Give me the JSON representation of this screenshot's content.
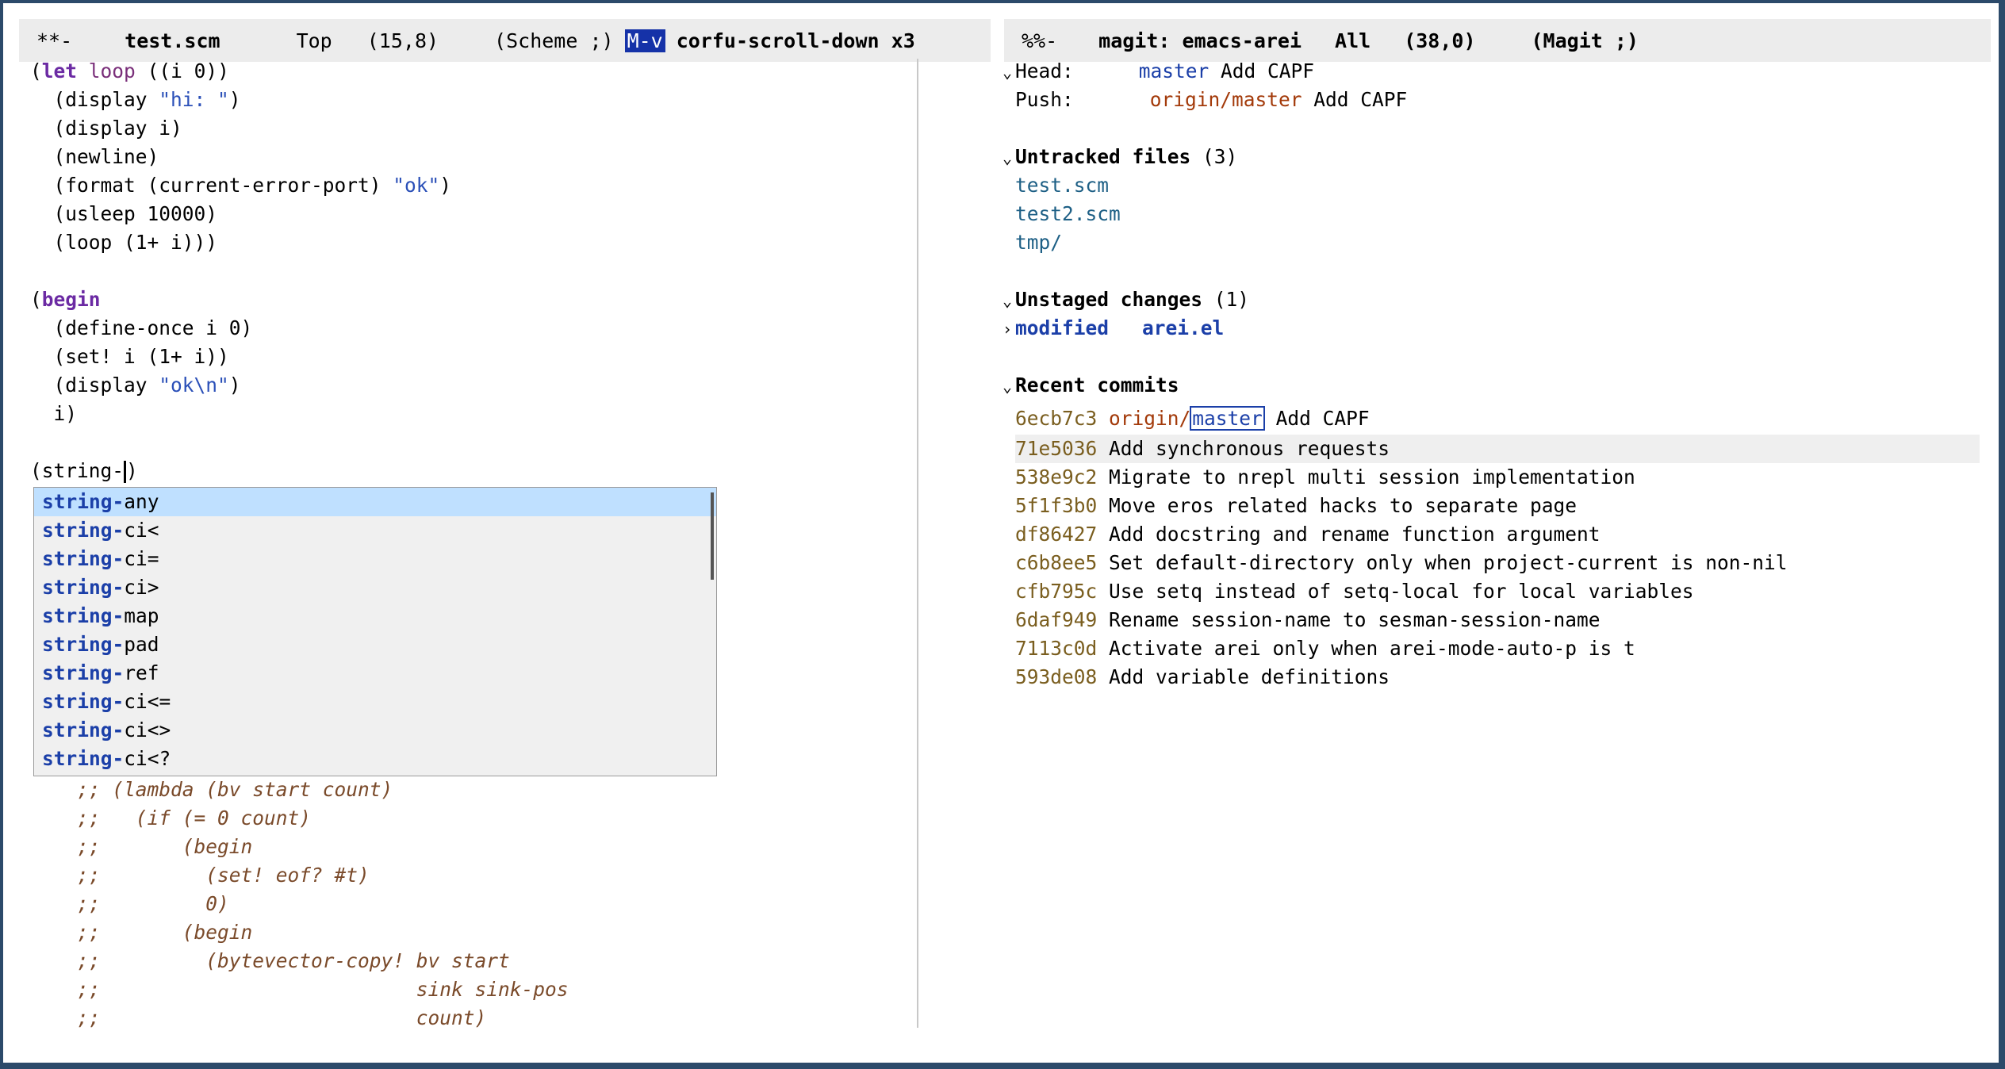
{
  "left_modeline": {
    "status": "**-",
    "buffer": "test.scm",
    "position": "Top",
    "linecol": "(15,8)",
    "mode": "(Scheme ;)",
    "keybind": "M-v",
    "command": "corfu-scroll-down x3"
  },
  "right_modeline": {
    "status": "%%-",
    "buffer": "magit: emacs-arei",
    "position": "All",
    "linecol": "(38,0)",
    "mode": "(Magit ;)"
  },
  "code": {
    "l1_open": "(",
    "l1_let": "let",
    "l1_sp": " ",
    "l1_loop": "loop",
    "l1_rest": " ((i 0))",
    "l2_pre": "  (display ",
    "l2_str": "\"hi: \"",
    "l2_post": ")",
    "l3": "  (display i)",
    "l4": "  (newline)",
    "l5_pre": "  (format (current-error-port) ",
    "l5_str": "\"ok\"",
    "l5_post": ")",
    "l6": "  (usleep 10000)",
    "l7": "  (loop (1+ i)))",
    "l9_open": "(",
    "l9_begin": "begin",
    "l10": "  (define-once i 0)",
    "l11": "  (set! i (1+ i))",
    "l12_pre": "  (display ",
    "l12_str": "\"ok\\n\"",
    "l12_post": ")",
    "l13": "  i)",
    "l15_pre": "(string-",
    "l15_post": ")",
    "c1": "    ;; (lambda (bv start count)",
    "c2": "    ;;   (if (= 0 count)",
    "c3": "    ;;       (begin",
    "c4": "    ;;         (set! eof? #t)",
    "c5": "    ;;         0)",
    "c6": "    ;;       (begin",
    "c7": "    ;;         (bytevector-copy! bv start",
    "c8": "    ;;                           sink sink-pos",
    "c9": "    ;;                           count)"
  },
  "completion": {
    "prefix": "string-",
    "candidates": [
      "any",
      "ci<",
      "ci=",
      "ci>",
      "map",
      "pad",
      "ref",
      "ci<=",
      "ci<>",
      "ci<?"
    ],
    "selected_index": 0
  },
  "magit": {
    "head_label": "Head:",
    "head_branch": "master",
    "head_msg": " Add CAPF",
    "push_label": "Push:",
    "push_branch": "origin/master",
    "push_msg": " Add CAPF",
    "untracked_title": "Untracked files",
    "untracked_count": " (3)",
    "untracked_files": [
      "test.scm",
      "test2.scm",
      "tmp/"
    ],
    "unstaged_title": "Unstaged changes",
    "unstaged_count": " (1)",
    "modified_label": "modified",
    "modified_file": "arei.el",
    "recent_title": "Recent commits",
    "first_commit": {
      "hash": "6ecb7c3",
      "remote": "origin/",
      "branch": "master",
      "msg": " Add CAPF"
    },
    "commits": [
      {
        "hash": "71e5036",
        "msg": "Add synchronous requests"
      },
      {
        "hash": "538e9c2",
        "msg": "Migrate to nrepl multi session implementation"
      },
      {
        "hash": "5f1f3b0",
        "msg": "Move eros related hacks to separate page"
      },
      {
        "hash": "df86427",
        "msg": "Add docstring and rename function argument"
      },
      {
        "hash": "c6b8ee5",
        "msg": "Set default-directory only when project-current is non-nil"
      },
      {
        "hash": "cfb795c",
        "msg": "Use setq instead of setq-local for local variables"
      },
      {
        "hash": "6daf949",
        "msg": "Rename session-name to sesman-session-name"
      },
      {
        "hash": "7113c0d",
        "msg": "Activate arei only when arei-mode-auto-p is t"
      },
      {
        "hash": "593de08",
        "msg": "Add variable definitions"
      }
    ]
  },
  "icons": {
    "expanded": "chevron-down-icon",
    "collapsed": "chevron-right-icon"
  }
}
